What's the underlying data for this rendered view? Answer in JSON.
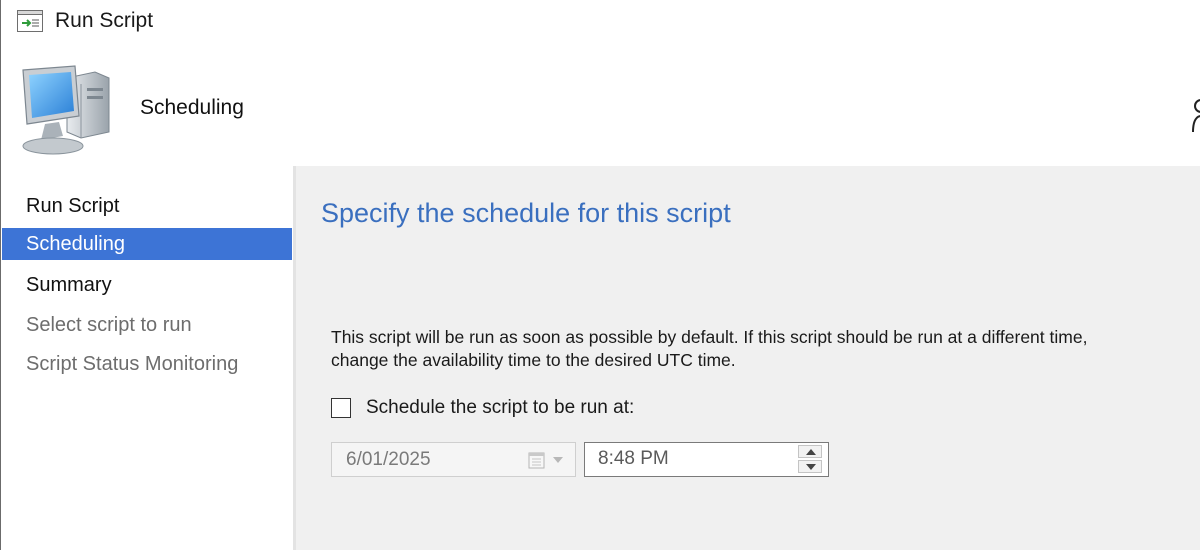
{
  "window": {
    "title": "Run Script",
    "title_icon": "run-script-icon"
  },
  "header": {
    "title": "Scheduling",
    "icon": "computer-icon"
  },
  "nav": {
    "items": [
      {
        "label": "Run Script",
        "state": "normal"
      },
      {
        "label": "Scheduling",
        "state": "selected"
      },
      {
        "label": "Summary",
        "state": "normal"
      },
      {
        "label": "Select script to run",
        "state": "disabled"
      },
      {
        "label": "Script Status Monitoring",
        "state": "disabled"
      }
    ]
  },
  "content": {
    "heading": "Specify the schedule for this script",
    "description_line1": "This script will be run as soon as possible by default. If this script should be run at a different time,",
    "description_line2": "change the availability time to the desired UTC time.",
    "schedule_checkbox": {
      "label": "Schedule the script to be run at:",
      "checked": false
    },
    "date_picker": {
      "value": "6/01/2025",
      "enabled": false,
      "icon": "calendar-icon"
    },
    "time_picker": {
      "value": "8:48 PM"
    }
  },
  "colors": {
    "selected_nav_bg": "#3d74d6",
    "heading_blue": "#3a6fbf",
    "content_bg": "#f0f0f0",
    "disabled_text": "#6d6d6d"
  }
}
